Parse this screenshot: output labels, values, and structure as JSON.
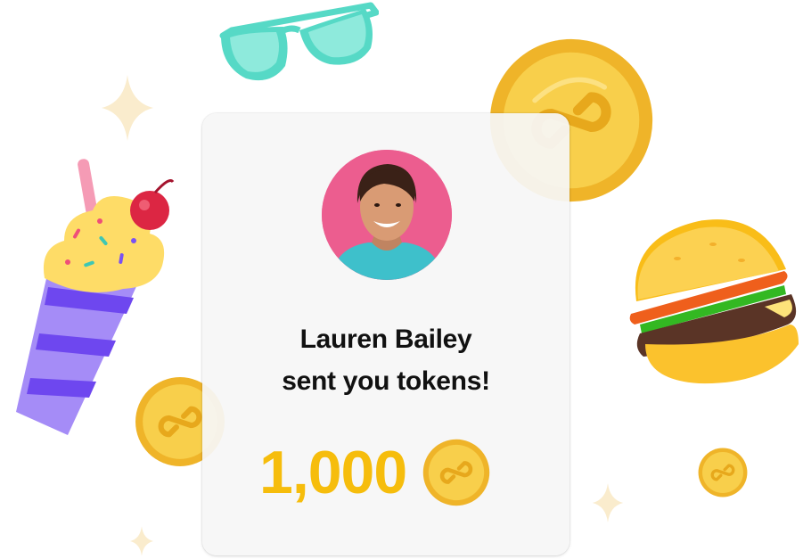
{
  "notification": {
    "sender_name": "Lauren Bailey",
    "message_suffix": "sent you tokens!",
    "amount": "1,000"
  },
  "icons": {
    "avatar": "avatar-photo",
    "token": "token-coin-icon",
    "decorations": [
      "sunglasses-icon",
      "milkshake-icon",
      "burger-icon",
      "sparkle-icon",
      "coin-icon"
    ]
  },
  "colors": {
    "amount": "#f6bd0c",
    "coin": "#f5c33b",
    "card_background": "#f6f6f6",
    "avatar_background": "#ec5d8f"
  }
}
